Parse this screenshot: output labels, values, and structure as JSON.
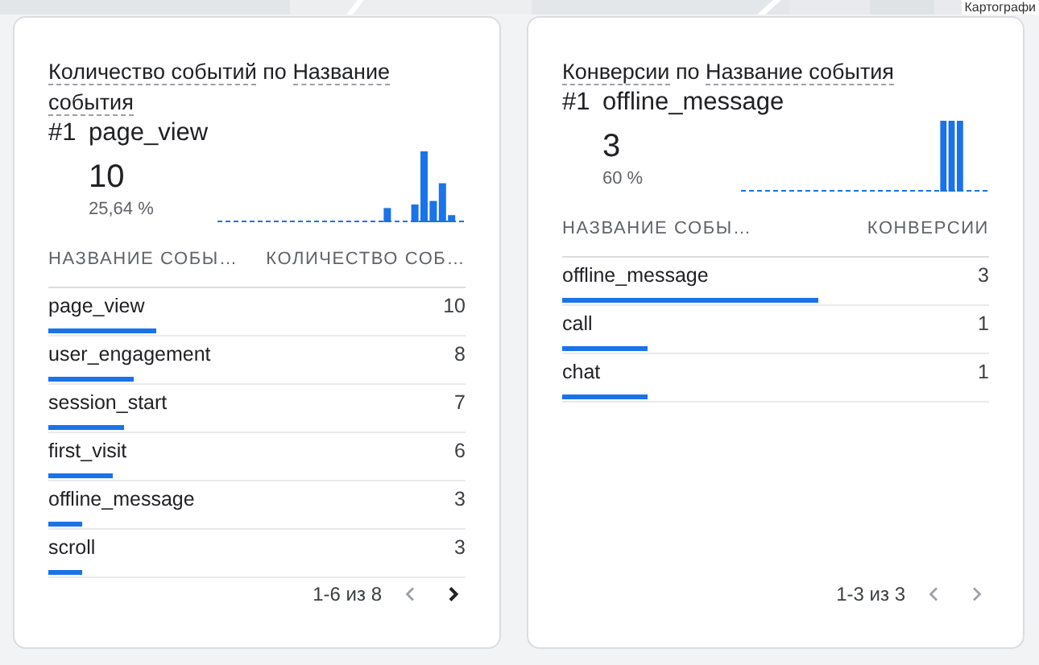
{
  "map": {
    "kind": "picture",
    "attribution": "Картографи"
  },
  "cards": [
    {
      "title": {
        "metric": "Количество событий",
        "joiner": "по",
        "dimension": "Название события"
      },
      "top_rank": "#1",
      "top_name": "page_view",
      "top_value": "10",
      "top_share": "25,64 %",
      "columns": [
        "НАЗВАНИЕ СОБЫ…",
        "КОЛИЧЕСТВО СОБ…"
      ],
      "rows": [
        {
          "name": "page_view",
          "value": "10",
          "level": 0.26
        },
        {
          "name": "user_engagement",
          "value": "8",
          "level": 0.205
        },
        {
          "name": "session_start",
          "value": "7",
          "level": 0.18
        },
        {
          "name": "first_visit",
          "value": "6",
          "level": 0.155
        },
        {
          "name": "offline_message",
          "value": "3",
          "level": 0.08
        },
        {
          "name": "scroll",
          "value": "3",
          "level": 0.08
        }
      ],
      "pager": {
        "range": "1-6 из 8",
        "prev_disabled": true,
        "next_disabled": false
      }
    },
    {
      "title": {
        "metric": "Конверсии",
        "joiner": "по",
        "dimension": "Название события"
      },
      "top_rank": "#1",
      "top_name": "offline_message",
      "top_value": "3",
      "top_share": "60 %",
      "columns": [
        "НАЗВАНИЕ СОБЫ…",
        "КОНВЕРСИИ"
      ],
      "rows": [
        {
          "name": "offline_message",
          "value": "3",
          "level": 0.6
        },
        {
          "name": "call",
          "value": "1",
          "level": 0.2
        },
        {
          "name": "chat",
          "value": "1",
          "level": 0.2
        }
      ],
      "pager": {
        "range": "1-3 из 3",
        "prev_disabled": true,
        "next_disabled": true
      }
    }
  ]
}
